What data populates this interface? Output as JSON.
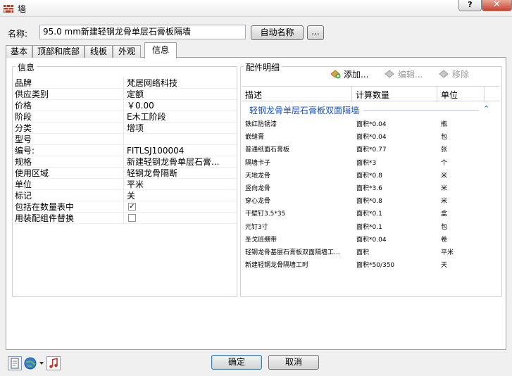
{
  "window": {
    "title": "墙"
  },
  "header": {
    "name_label": "名称:",
    "name_value": "95.0 mm新建轻钢龙骨单层石膏板隔墙",
    "autoname_button": "自动名称",
    "more_button": "..."
  },
  "tabs": [
    {
      "label": "基本"
    },
    {
      "label": "顶部和底部"
    },
    {
      "label": "线板"
    },
    {
      "label": "外观"
    },
    {
      "label": "信息"
    }
  ],
  "info": {
    "group_title": "信息",
    "rows": [
      {
        "key": "品牌",
        "value": "梵居网络科技"
      },
      {
        "key": "供应类别",
        "value": "定额"
      },
      {
        "key": "价格",
        "value": "￥0.00"
      },
      {
        "key": "阶段",
        "value": "E木工阶段"
      },
      {
        "key": "分类",
        "value": "增项"
      },
      {
        "key": "型号",
        "value": ""
      },
      {
        "key": "编号:",
        "value": "FITLSJ100004"
      },
      {
        "key": "规格",
        "value": "新建轻钢龙骨单层石膏..."
      },
      {
        "key": "使用区域",
        "value": "轻钢龙骨隔断"
      },
      {
        "key": "单位",
        "value": "平米"
      },
      {
        "key": "标记",
        "value": "关"
      },
      {
        "key": "包括在数量表中",
        "checked": true
      },
      {
        "key": "用装配组件替换",
        "checked": false
      }
    ]
  },
  "parts": {
    "group_title": "配件明细",
    "toolbar": {
      "add": "添加...",
      "edit": "编辑...",
      "remove": "移除"
    },
    "columns": [
      "描述",
      "计算数量",
      "单位"
    ],
    "section_title": "轻钢龙骨单层石膏板双面隔墙",
    "rows": [
      {
        "desc": "铁红防锈漆",
        "qty": "面积*0.04",
        "unit": "瓶"
      },
      {
        "desc": "嵌缝膏",
        "qty": "面积*0.04",
        "unit": "包"
      },
      {
        "desc": "普通纸面石膏板",
        "qty": "面积*0.77",
        "unit": "张"
      },
      {
        "desc": "隔墙卡子",
        "qty": "面积*3",
        "unit": "个"
      },
      {
        "desc": "天地龙骨",
        "qty": "面积*0.8",
        "unit": "米"
      },
      {
        "desc": "竖向龙骨",
        "qty": "面积*3.6",
        "unit": "米"
      },
      {
        "desc": "穿心龙骨",
        "qty": "面积*0.8",
        "unit": "米"
      },
      {
        "desc": "干壁钉3.5*35",
        "qty": "面积*0.1",
        "unit": "盒"
      },
      {
        "desc": "元钉3寸",
        "qty": "面积*0.1",
        "unit": "包"
      },
      {
        "desc": "圣戈班绷带",
        "qty": "面积*0.04",
        "unit": "卷"
      },
      {
        "desc": "轻钢龙骨基层石膏板双面隔墙工...",
        "qty": "面积",
        "unit": "平米"
      },
      {
        "desc": "新建轻钢龙骨隔墙工时",
        "qty": "面积*50/350",
        "unit": "天"
      }
    ]
  },
  "footer": {
    "ok": "确定",
    "cancel": "取消"
  },
  "colors": {
    "section_blue": "#1b4fbf",
    "accent_border": "#3c7fb1"
  }
}
